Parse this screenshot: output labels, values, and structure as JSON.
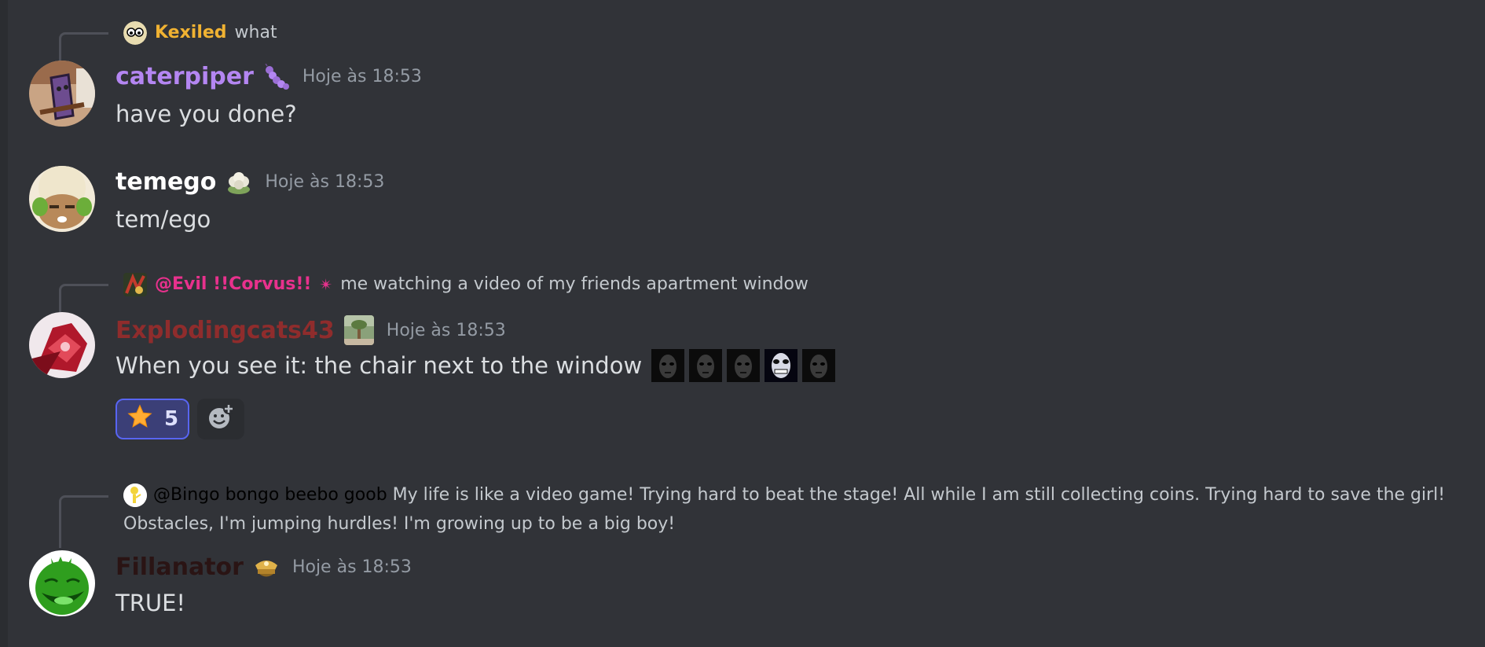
{
  "messages": [
    {
      "reply": {
        "author": "Kexiled",
        "author_color": "#f0b232",
        "text": "what"
      },
      "author": "caterpiper",
      "author_color": "#b486f2",
      "role_icon": "caterpillar-icon",
      "timestamp": "Hoje às 18:53",
      "content": "have you done?"
    },
    {
      "author": "temego",
      "author_color": "#ffffff",
      "role_icon": "cauliflower-icon",
      "timestamp": "Hoje às 18:53",
      "content": "tem/ego"
    },
    {
      "reply": {
        "author": "@Evil !!Corvus!!",
        "author_color": "#e8318d",
        "badge": "✴",
        "text": "me watching a video of my friends apartment window"
      },
      "author": "Explodingcats43",
      "author_color": "#8f2c2c",
      "role_icon": "tree-photo-icon",
      "timestamp": "Hoje às 18:53",
      "content": "When you see it: the chair next to the window",
      "inline_emojis": [
        "dark-face-emoji",
        "dark-face-emoji",
        "dark-face-emoji",
        "bright-face-emoji",
        "dark-face-emoji"
      ],
      "reactions": [
        {
          "emoji": "star-icon",
          "count": "5"
        }
      ]
    },
    {
      "reply": {
        "author": "@Bingo bongo beebo goob",
        "author_color": "#000000",
        "text": "My life is like a video game! Trying hard to beat the stage! All while I am still collecting coins. Trying hard to save the girl! Obstacles, I'm jumping hurdles! I'm growing up to be a big boy!"
      },
      "author": "Fillanator",
      "author_color": "#2a1414",
      "role_icon": "police-cap-icon",
      "timestamp": "Hoje às 18:53",
      "content": "TRUE!"
    }
  ],
  "colors": {
    "background": "#313338",
    "timestamp": "#949ba4",
    "reaction_active": "#3b3f77",
    "reaction_border": "#5865f2"
  }
}
